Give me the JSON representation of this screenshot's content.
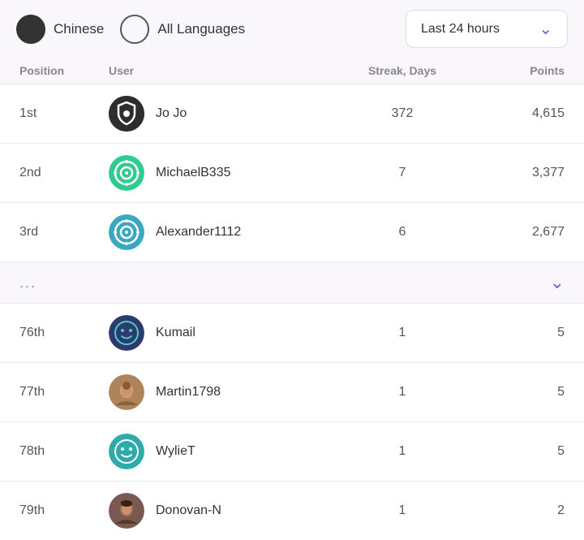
{
  "filters": {
    "chinese": {
      "label": "Chinese",
      "selected": true
    },
    "all_languages": {
      "label": "All Languages",
      "selected": false
    }
  },
  "dropdown": {
    "label": "Last 24 hours"
  },
  "table": {
    "headers": {
      "position": "Position",
      "user": "User",
      "streak": "Streak, Days",
      "points": "Points"
    },
    "top_rows": [
      {
        "position": "1st",
        "username": "Jo Jo",
        "streak": "372",
        "points": "4,615",
        "avatar_type": "shield",
        "avatar_color": "#2d2d2d"
      },
      {
        "position": "2nd",
        "username": "MichaelB335",
        "streak": "7",
        "points": "3,377",
        "avatar_type": "target",
        "avatar_color": "#2ecc8e"
      },
      {
        "position": "3rd",
        "username": "Alexander1112",
        "streak": "6",
        "points": "2,677",
        "avatar_type": "target2",
        "avatar_color": "#3aa8c0"
      }
    ],
    "bottom_rows": [
      {
        "position": "76th",
        "username": "Kumail",
        "streak": "1",
        "points": "5",
        "avatar_type": "smiley",
        "avatar_color": "#2d3a6e"
      },
      {
        "position": "77th",
        "username": "Martin1798",
        "streak": "1",
        "points": "5",
        "avatar_type": "photo",
        "avatar_color": "#b0845a"
      },
      {
        "position": "78th",
        "username": "WylieT",
        "streak": "1",
        "points": "5",
        "avatar_type": "smiley2",
        "avatar_color": "#2eaaaa"
      },
      {
        "position": "79th",
        "username": "Donovan-N",
        "streak": "1",
        "points": "2",
        "avatar_type": "photo2",
        "avatar_color": "#8b6a5a"
      }
    ]
  }
}
